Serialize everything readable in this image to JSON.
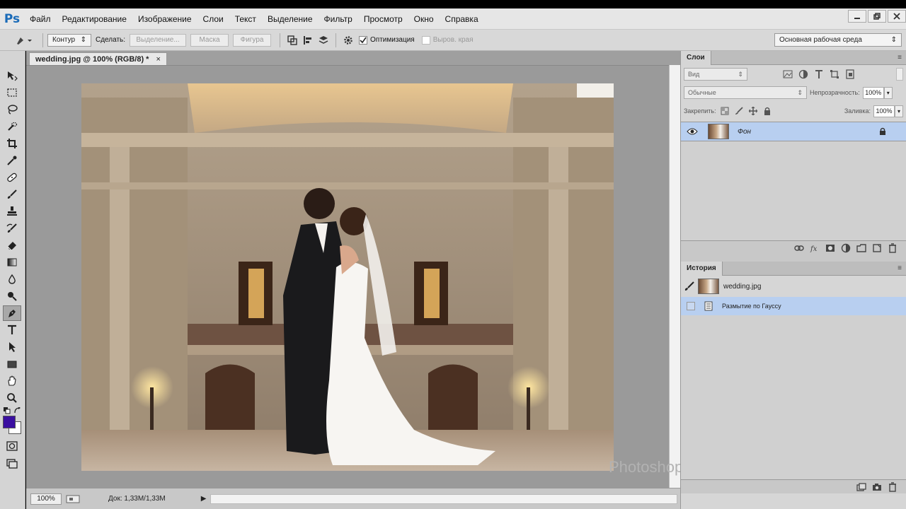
{
  "menu": {
    "logo": "Ps",
    "items": [
      "Файл",
      "Редактирование",
      "Изображение",
      "Слои",
      "Текст",
      "Выделение",
      "Фильтр",
      "Просмотр",
      "Окно",
      "Справка"
    ]
  },
  "options": {
    "mode": "Контур",
    "make_label": "Сделать:",
    "make_buttons": [
      "Выделение...",
      "Маска",
      "Фигура"
    ],
    "optimize_label": "Оптимизация",
    "optimize_checked": true,
    "align_edges_label": "Выров. края",
    "workspace": "Основная рабочая среда"
  },
  "document": {
    "tab_title": "wedding.jpg @ 100% (RGB/8) *",
    "close": "×",
    "zoom": "100%",
    "doc_size": "Док: 1,33М/1,33М"
  },
  "watermark": "Photoshop-help.ru | Сергей Иванов",
  "layers_panel": {
    "title": "Слои",
    "filter": "Вид",
    "blend_mode": "Обычные",
    "opacity_label": "Непрозрачность:",
    "opacity": "100%",
    "lock_label": "Закрепить:",
    "fill_label": "Заливка:",
    "fill": "100%",
    "layers": [
      {
        "name": "Фон",
        "visible": true,
        "locked": true
      }
    ]
  },
  "history_panel": {
    "title": "История",
    "snapshot": "wedding.jpg",
    "steps": [
      "Размытие по Гауссу"
    ]
  },
  "colors": {
    "foreground": "#3a0fa0",
    "background": "#ffffff",
    "selection": "#b8cff0"
  }
}
